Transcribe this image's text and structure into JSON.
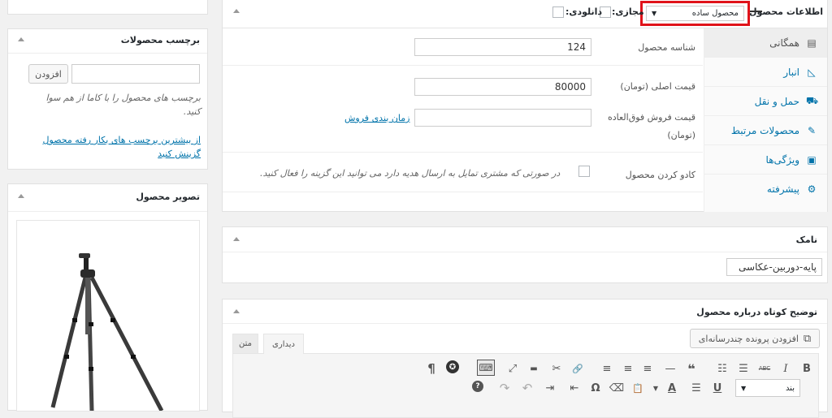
{
  "sidebar": {
    "tags": {
      "title": "برچسب محصولات",
      "add_button": "افزودن",
      "input_value": "",
      "help": "برچسب های محصول را با کاما از هم سوا کنید.",
      "link": "از بیشترین برچسب های بکار رفته محصول گزینش کنید"
    },
    "image": {
      "title": "تصویر محصول"
    }
  },
  "product_data": {
    "title": "اطلاعات محصول",
    "type_select": "محصول ساده",
    "virtual_label": "مجازی:",
    "downloadable_label": "دانلودی:",
    "tabs": [
      {
        "label": "همگانی",
        "icon": "general-icon",
        "glyph": "▤",
        "active": true
      },
      {
        "label": "انبار",
        "icon": "inventory-icon",
        "glyph": "◺",
        "active": false
      },
      {
        "label": "حمل و نقل",
        "icon": "shipping-icon",
        "glyph": "⛟",
        "active": false
      },
      {
        "label": "محصولات مرتبط",
        "icon": "linked-products-icon",
        "glyph": "✎",
        "active": false
      },
      {
        "label": "ویژگی‌ها",
        "icon": "attributes-icon",
        "glyph": "▣",
        "active": false
      },
      {
        "label": "پیشرفته",
        "icon": "advanced-icon",
        "glyph": "⚙",
        "active": false
      }
    ],
    "fields": {
      "sku_label": "شناسه محصول",
      "sku_value": "124",
      "regular_price_label": "قیمت اصلی (تومان)",
      "regular_price_value": "80000",
      "sale_price_label": "قیمت فروش فوق‌العاده",
      "sale_price_unit": "(تومان)",
      "sale_price_value": "",
      "schedule_link": "زمان بندی فروش",
      "gift_label": "کادو کردن محصول",
      "gift_desc": "در صورتی که مشتری تمایل به ارسال هدیه دارد می توانید این گزینه را فعال کنید."
    }
  },
  "name_box": {
    "title": "نامک",
    "value": "پایه-دوربین-عکاسی"
  },
  "short_desc": {
    "title": "توضیح کوتاه درباره محصول",
    "add_media": "افزودن پرونده چندرسانه‌ای",
    "tab_visual": "دیداری",
    "tab_text": "متن",
    "format_select": "بند",
    "toolbar_row1": [
      {
        "name": "bold-icon",
        "glyph": "B"
      },
      {
        "name": "italic-icon",
        "glyph": "I"
      },
      {
        "name": "strikethrough-icon",
        "glyph": "ABC"
      },
      {
        "name": "bullet-list-icon",
        "glyph": "☰"
      },
      {
        "name": "numbered-list-icon",
        "glyph": "☷"
      },
      {
        "name": "blockquote-icon",
        "glyph": "❝"
      },
      {
        "name": "horizontal-line-icon",
        "glyph": "—"
      },
      {
        "name": "align-left-icon",
        "glyph": "≡"
      },
      {
        "name": "align-center-icon",
        "glyph": "≡"
      },
      {
        "name": "align-right-icon",
        "glyph": "≡"
      },
      {
        "name": "link-icon",
        "glyph": "🔗"
      },
      {
        "name": "unlink-icon",
        "glyph": "✂"
      },
      {
        "name": "read-more-icon",
        "glyph": "▬"
      },
      {
        "name": "fullscreen-icon",
        "glyph": "⤢"
      },
      {
        "name": "toolbar-toggle-icon",
        "glyph": "⌨"
      },
      {
        "name": "wpforms-icon",
        "glyph": "✪"
      },
      {
        "name": "paragraph-icon",
        "glyph": "¶"
      }
    ],
    "toolbar_row2": [
      {
        "name": "underline-icon",
        "glyph": "U"
      },
      {
        "name": "justify-icon",
        "glyph": "☰"
      },
      {
        "name": "text-color-icon",
        "glyph": "A"
      },
      {
        "name": "paste-text-icon",
        "glyph": "📋"
      },
      {
        "name": "clear-format-icon",
        "glyph": "⌫"
      },
      {
        "name": "special-char-icon",
        "glyph": "Ω"
      },
      {
        "name": "outdent-icon",
        "glyph": "⇤"
      },
      {
        "name": "indent-icon",
        "glyph": "⇥"
      },
      {
        "name": "undo-icon",
        "glyph": "↶"
      },
      {
        "name": "redo-icon",
        "glyph": "↷"
      },
      {
        "name": "help-icon",
        "glyph": "?"
      }
    ]
  }
}
